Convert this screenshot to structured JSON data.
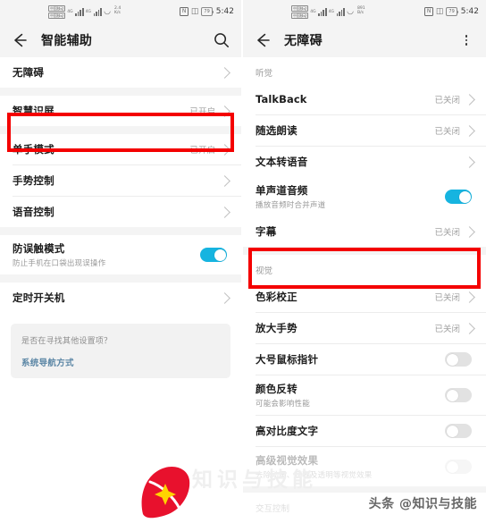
{
  "left_phone": {
    "status_bar": {
      "carrier_badges": [
        "中国移动",
        "中国移动"
      ],
      "net_label": "4G",
      "net_label2": "4G",
      "wifi_icon": "wifi-icon",
      "net_speed_value": "2.4",
      "net_speed_unit": "K/s",
      "nfc_icon": "nfc-icon",
      "vibrate_icon": "vibrate-icon",
      "battery": "79",
      "time": "5:42"
    },
    "app_bar": {
      "back_icon": "back-arrow-icon",
      "title": "智能辅助",
      "search_icon": "search-icon"
    },
    "rows": [
      {
        "title": "无障碍",
        "sub": "",
        "value": "",
        "control": "chevron",
        "highlighted": true
      },
      {
        "title": "智慧识屏",
        "sub": "",
        "value": "已开启",
        "control": "chevron"
      },
      {
        "title": "单手模式",
        "sub": "",
        "value": "已开启",
        "control": "chevron"
      },
      {
        "title": "手势控制",
        "sub": "",
        "value": "",
        "control": "chevron"
      },
      {
        "title": "语音控制",
        "sub": "",
        "value": "",
        "control": "chevron"
      },
      {
        "title": "防误触模式",
        "sub": "防止手机在口袋出现误操作",
        "value": "",
        "control": "toggle",
        "toggle_on": true
      },
      {
        "title": "定时开关机",
        "sub": "",
        "value": "",
        "control": "chevron"
      }
    ],
    "help_card": {
      "question": "是否在寻找其他设置项？",
      "link": "系统导航方式"
    }
  },
  "right_phone": {
    "status_bar": {
      "carrier_badges": [
        "中国移动",
        "中国移动"
      ],
      "net_label": "4G",
      "net_label2": "4G",
      "wifi_icon": "wifi-icon",
      "net_speed_value": "891",
      "net_speed_unit": "B/s",
      "nfc_icon": "nfc-icon",
      "vibrate_icon": "vibrate-icon",
      "battery": "79",
      "time": "5:42"
    },
    "app_bar": {
      "back_icon": "back-arrow-icon",
      "title": "无障碍",
      "more_icon": "more-vertical-icon"
    },
    "section_hearing": "听觉",
    "hearing_rows": [
      {
        "title": "TalkBack",
        "sub": "",
        "value": "已关闭",
        "control": "chevron",
        "latin": true
      },
      {
        "title": "随选朗读",
        "sub": "",
        "value": "已关闭",
        "control": "chevron"
      },
      {
        "title": "文本转语音",
        "sub": "",
        "value": "",
        "control": "chevron"
      },
      {
        "title": "单声道音频",
        "sub": "播放音频时合并声道",
        "value": "",
        "control": "toggle",
        "toggle_on": true,
        "highlighted": true
      },
      {
        "title": "字幕",
        "sub": "",
        "value": "已关闭",
        "control": "chevron"
      }
    ],
    "section_vision": "视觉",
    "vision_rows": [
      {
        "title": "色彩校正",
        "sub": "",
        "value": "已关闭",
        "control": "chevron"
      },
      {
        "title": "放大手势",
        "sub": "",
        "value": "已关闭",
        "control": "chevron"
      },
      {
        "title": "大号鼠标指针",
        "sub": "",
        "value": "",
        "control": "toggle",
        "toggle_on": false
      },
      {
        "title": "颜色反转",
        "sub": "可能会影响性能",
        "value": "",
        "control": "toggle",
        "toggle_on": false
      },
      {
        "title": "高对比度文字",
        "sub": "",
        "value": "",
        "control": "toggle",
        "toggle_on": false
      },
      {
        "title": "高级视觉效果",
        "sub": "去除动画、模糊及透明等视觉效果",
        "value": "",
        "control": "toggle",
        "toggle_on": false,
        "faded": true
      }
    ],
    "section_interaction": "交互控制"
  },
  "watermark": {
    "text": "头条 @知识与技能",
    "ghost_text": "知识与技能",
    "logo_icon": "toutiao-logo-icon"
  },
  "colors": {
    "accent_toggle_on": "#16b4e0",
    "highlight_box": "#f40000",
    "link_blue": "#5b86a5",
    "status_bg": "#f4f4f4"
  }
}
